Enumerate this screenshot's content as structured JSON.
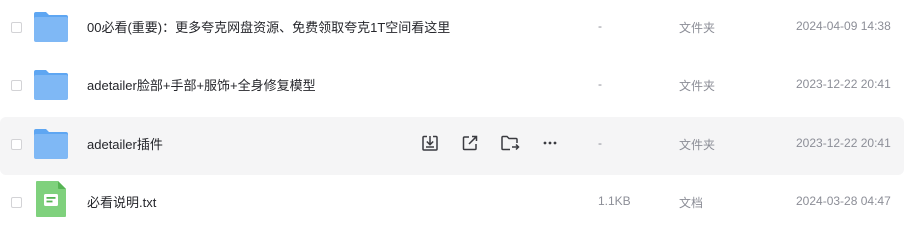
{
  "colors": {
    "folder": "#7fb8f5",
    "folder_back": "#5ea6f2",
    "doc": "#6cc36a",
    "row_hover_bg": "#f5f5f6",
    "meta_text": "#8c8e97"
  },
  "files": [
    {
      "name": "00必看(重要)：更多夸克网盘资源、免费领取夸克1T空间看这里",
      "size": "-",
      "type": "文件夹",
      "modified": "2024-04-09 14:38",
      "icon": "folder-icon"
    },
    {
      "name": "adetailer脸部+手部+服饰+全身修复模型",
      "size": "-",
      "type": "文件夹",
      "modified": "2023-12-22 20:41",
      "icon": "folder-icon"
    },
    {
      "name": "adetailer插件",
      "size": "-",
      "type": "文件夹",
      "modified": "2023-12-22 20:41",
      "icon": "folder-icon",
      "hovered": true
    },
    {
      "name": "必看说明.txt",
      "size": "1.1KB",
      "type": "文档",
      "modified": "2024-03-28 04:47",
      "icon": "text-document-icon"
    }
  ],
  "row_actions": [
    "download-icon",
    "share-icon",
    "move-to-folder-icon",
    "more-icon"
  ]
}
